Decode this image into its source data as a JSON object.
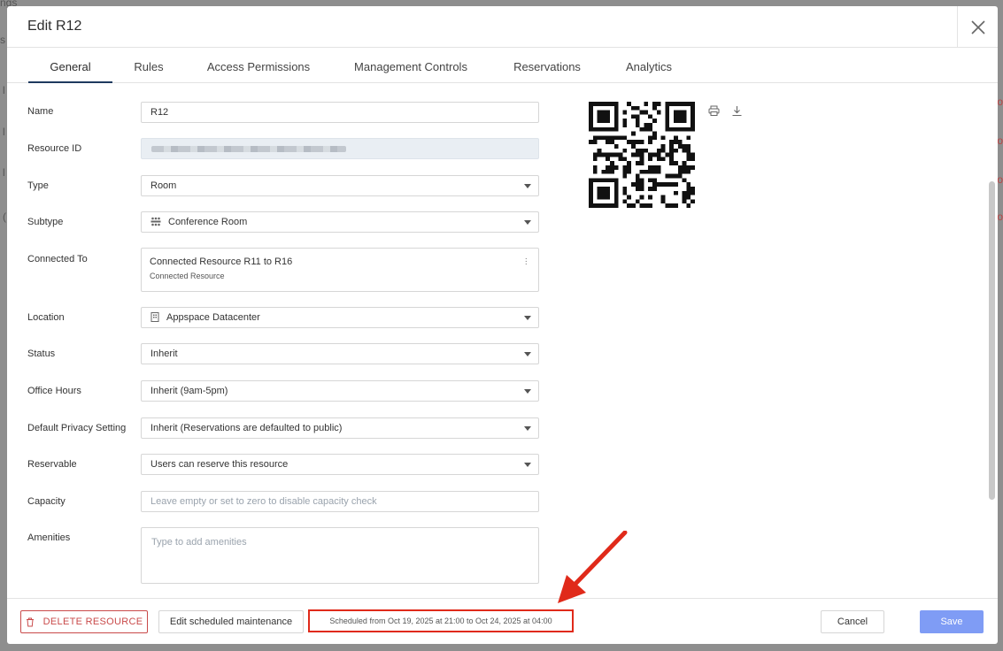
{
  "modal": {
    "title": "Edit R12"
  },
  "tabs": [
    {
      "label": "General",
      "active": true
    },
    {
      "label": "Rules"
    },
    {
      "label": "Access Permissions"
    },
    {
      "label": "Management Controls"
    },
    {
      "label": "Reservations"
    },
    {
      "label": "Analytics"
    }
  ],
  "form": {
    "name": {
      "label": "Name",
      "value": "R12"
    },
    "resource_id": {
      "label": "Resource ID"
    },
    "type": {
      "label": "Type",
      "value": "Room"
    },
    "subtype": {
      "label": "Subtype",
      "value": "Conference Room",
      "icon": "conference-room-icon"
    },
    "connected_to": {
      "label": "Connected To",
      "title": "Connected Resource R11 to R16",
      "subtitle": "Connected Resource"
    },
    "location": {
      "label": "Location",
      "value": "Appspace Datacenter",
      "icon": "building-icon"
    },
    "status": {
      "label": "Status",
      "value": "Inherit"
    },
    "office_hours": {
      "label": "Office Hours",
      "value": "Inherit (9am-5pm)"
    },
    "privacy": {
      "label": "Default Privacy Setting",
      "value": "Inherit (Reservations are defaulted to public)"
    },
    "reservable": {
      "label": "Reservable",
      "value": "Users can reserve this resource"
    },
    "capacity": {
      "label": "Capacity",
      "placeholder": "Leave empty or set to zero to disable capacity check"
    },
    "amenities": {
      "label": "Amenities",
      "placeholder": "Type to add amenities"
    }
  },
  "footer": {
    "delete_label": "DELETE RESOURCE",
    "maintenance_label": "Edit scheduled maintenance",
    "schedule_text": "Scheduled from Oct 19, 2025 at 21:00 to Oct 24, 2025 at 04:00",
    "cancel_label": "Cancel",
    "save_label": "Save"
  },
  "colors": {
    "accent": "#7f9cf5",
    "danger": "#c94a4a",
    "annotation": "#e02a1a",
    "tab_underline": "#1e3a5f"
  }
}
